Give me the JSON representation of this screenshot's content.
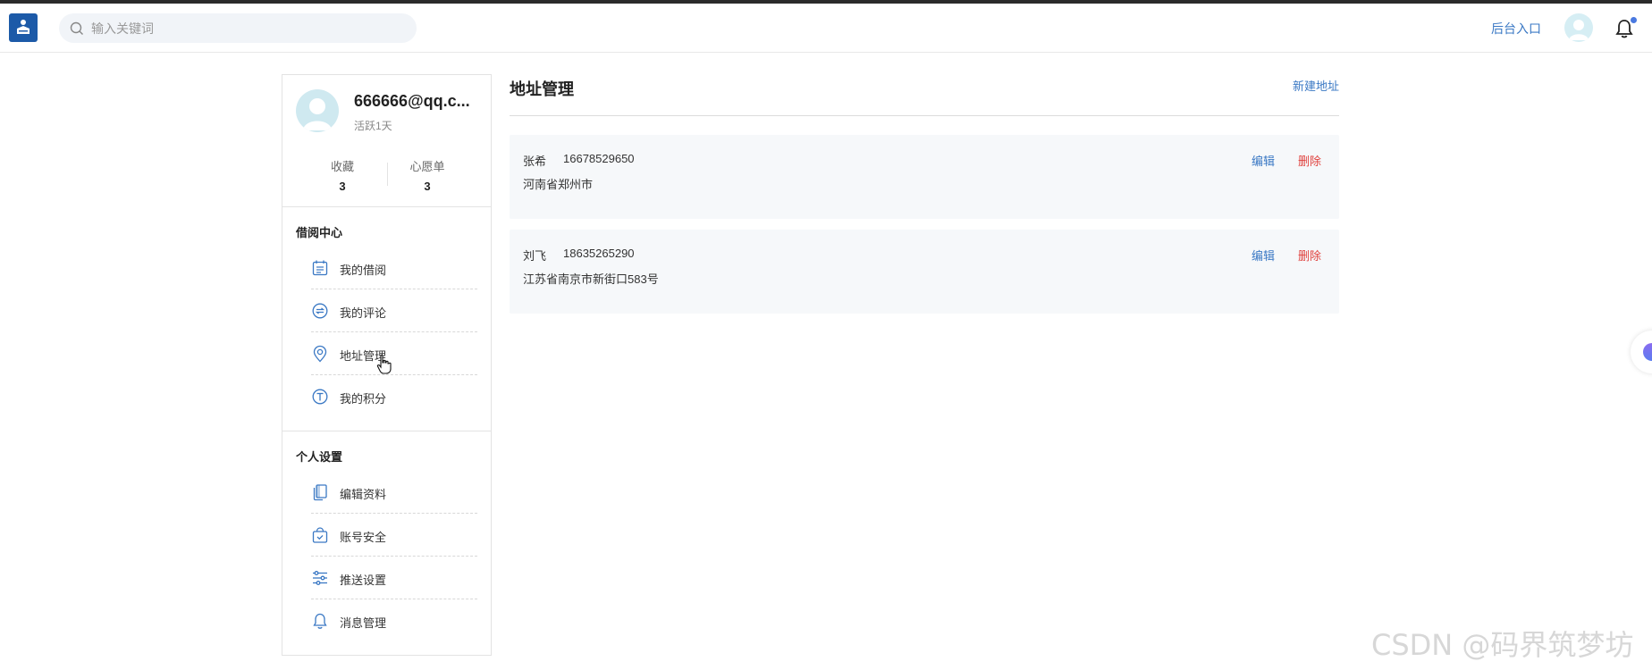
{
  "header": {
    "search_placeholder": "输入关键词",
    "admin_link": "后台入口"
  },
  "profile": {
    "name": "666666@qq.c...",
    "active": "活跃1天",
    "stats": [
      {
        "label": "收藏",
        "value": "3"
      },
      {
        "label": "心愿单",
        "value": "3"
      }
    ]
  },
  "sidebar": {
    "sections": [
      {
        "title": "借阅中心",
        "items": [
          {
            "label": "我的借阅",
            "icon": "calendar-icon"
          },
          {
            "label": "我的评论",
            "icon": "comment-icon"
          },
          {
            "label": "地址管理",
            "icon": "location-pin-icon"
          },
          {
            "label": "我的积分",
            "icon": "points-icon"
          }
        ]
      },
      {
        "title": "个人设置",
        "items": [
          {
            "label": "编辑资料",
            "icon": "documents-icon"
          },
          {
            "label": "账号安全",
            "icon": "shield-bag-icon"
          },
          {
            "label": "推送设置",
            "icon": "sliders-icon"
          },
          {
            "label": "消息管理",
            "icon": "bell-icon"
          }
        ]
      }
    ]
  },
  "main": {
    "title": "地址管理",
    "new_address": "新建地址",
    "addresses": [
      {
        "name": "张希",
        "phone": "16678529650",
        "address": "河南省郑州市",
        "edit": "编辑",
        "delete": "删除"
      },
      {
        "name": "刘飞",
        "phone": "18635265290",
        "address": "江苏省南京市新街口583号",
        "edit": "编辑",
        "delete": "删除"
      }
    ]
  },
  "watermark": "CSDN @码界筑梦坊",
  "colors": {
    "accent": "#3a78c4",
    "danger": "#e0423e",
    "logo_bg": "#1c5aa8",
    "card_bg": "#f6f8fa"
  }
}
